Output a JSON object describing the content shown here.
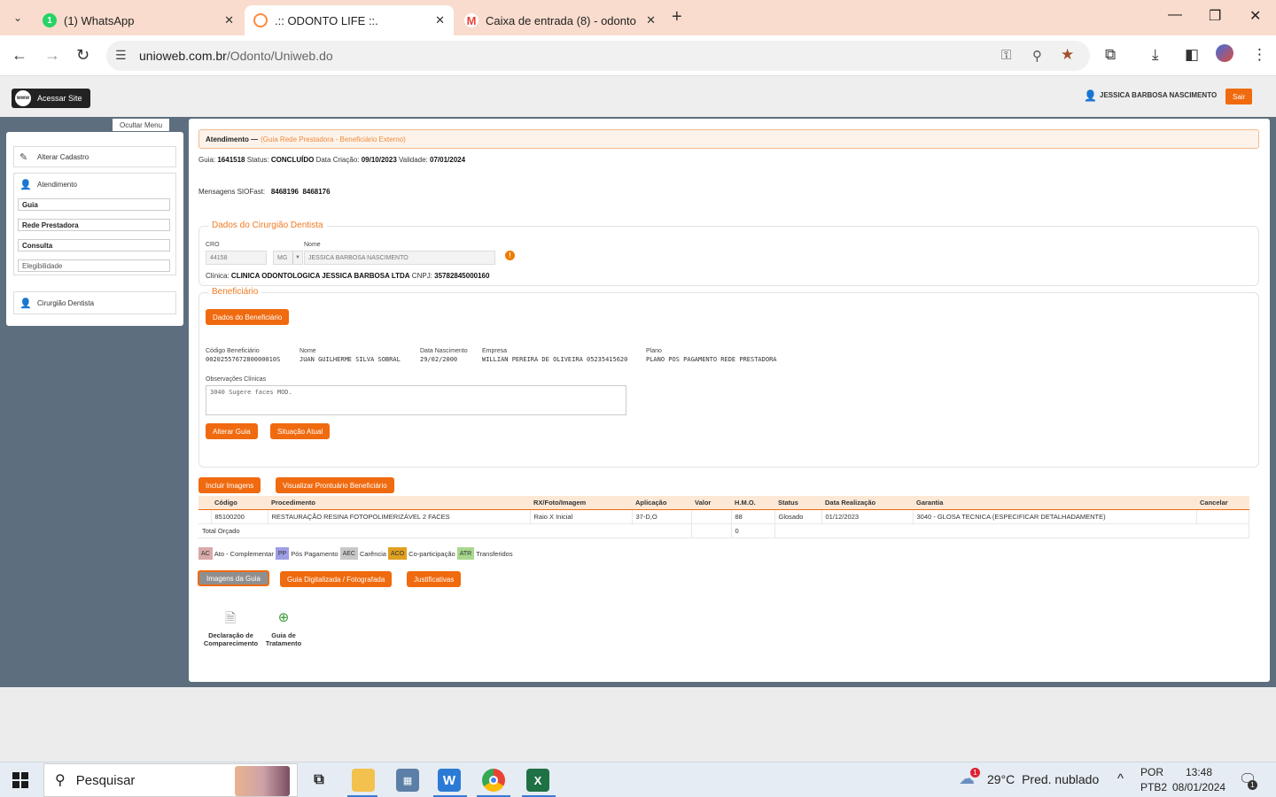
{
  "browser": {
    "tabs": [
      {
        "label": "(1) WhatsApp",
        "icon": "whatsapp-icon",
        "color": "#25d366"
      },
      {
        "label": ".:: ODONTO LIFE ::.",
        "icon": "odonto-icon",
        "color": "#ff8a3a"
      },
      {
        "label": "Caixa de entrada (8) - odontom",
        "icon": "gmail-icon",
        "color": "#ea4335"
      }
    ],
    "url_host": "unioweb.com.br",
    "url_path": "/Odonto/Uniweb.do"
  },
  "header": {
    "site_button": "Acessar Site",
    "site_badge": "www",
    "user_name": "JESSICA BARBOSA NASCIMENTO",
    "logout": "Sair"
  },
  "sidebar": {
    "hide_menu": "Ocultar Menu",
    "alterar_cadastro": "Alterar Cadastro",
    "atendimento": "Atendimento",
    "sub_items": [
      "Guia",
      "Rede Prestadora",
      "Consulta",
      "Elegibilidade"
    ],
    "cirurgiao": "Cirurgião Dentista"
  },
  "main": {
    "title": "Atendimento",
    "title_sep": "—",
    "subtitle": "(Guia Rede Prestadora - Beneficiário Externo)",
    "guia_label": "Guia:",
    "guia_value": "1641518",
    "status_label": "Status:",
    "status_value": "CONCLUÍDO",
    "criacao_label": "Data Criação:",
    "criacao_value": "09/10/2023",
    "validade_label": "Validade:",
    "validade_value": "07/01/2024",
    "siofast_label": "Mensagens SIOFast:",
    "siofast_values": [
      "8468196",
      "8468176"
    ]
  },
  "dentista": {
    "legend": "Dados do Cirurgião Dentista",
    "cro_label": "CRO",
    "cro_value": "44158",
    "uf_value": "MG",
    "nome_label": "Nome",
    "nome_value": "JESSICA BARBOSA NASCIMENTO",
    "clinica_label": "Clínica:",
    "clinica_value": "CLINICA ODONTOLOGICA JESSICA BARBOSA LTDA",
    "cnpj_label": "CNPJ:",
    "cnpj_value": "35782845000160"
  },
  "beneficiario": {
    "legend": "Beneficiário",
    "dados_button": "Dados do Beneficiário",
    "codigo_label": "Código Beneficiário",
    "codigo_value": "0020255767280000010S",
    "nome_label": "Nome",
    "nome_value": "JUAN GUILHERME SILVA SOBRAL",
    "nasc_label": "Data Nascimento",
    "nasc_value": "29/02/2000",
    "empresa_label": "Empresa",
    "empresa_value": "WILLIAN PEREIRA DE OLIVEIRA 05235415620",
    "plano_label": "Plano",
    "plano_value": "PLANO POS PAGAMENTO REDE PRESTADORA",
    "obs_label": "Observações Clínicas",
    "obs_value": "3040 Sugere faces MOD.",
    "alterar_button": "Alterar Guia",
    "situacao_button": "Situação Atual"
  },
  "actions": {
    "incluir_imagens": "Incluir Imagens",
    "visualizar_prontuario": "Visualizar Prontuário Beneficiário"
  },
  "table": {
    "headers": [
      "Código",
      "Procedimento",
      "RX/Foto/Imagem",
      "Aplicação",
      "Valor",
      "H.M.O.",
      "Status",
      "Data Realização",
      "Garantia",
      "Cancelar"
    ],
    "row": [
      "85100200",
      "RESTAURAÇÃO RESINA FOTOPOLIMERIZÁVEL 2 FACES",
      "Raio X Inicial",
      "37-D,O",
      "",
      "88",
      "Glosado",
      "01/12/2023",
      "3040 - GLOSA TECNICA (ESPECIFICAR DETALHADAMENTE)",
      ""
    ],
    "total_label": "Total Orçado",
    "total_hmo": "0"
  },
  "legend": [
    {
      "code": "AC",
      "label": "Ato - Complementar",
      "color": "#d9a9a9"
    },
    {
      "code": "PP",
      "label": "Pós Pagamento",
      "color": "#9e9ee6"
    },
    {
      "code": "AEC",
      "label": "Carência",
      "color": "#c8c8c8"
    },
    {
      "code": "ACO",
      "label": "Co-participação",
      "color": "#e0a020"
    },
    {
      "code": "ATR",
      "label": "Transferidos",
      "color": "#a8d88e"
    }
  ],
  "bottom_buttons": {
    "imagens_guia": "Imagens da Guia",
    "guia_digitalizada": "Guia Digitalizada / Fotografada",
    "justificativas": "Justificativas"
  },
  "docs": [
    {
      "line1": "Declaração de",
      "line2": "Comparecimento",
      "icon": "document-icon"
    },
    {
      "line1": "Guia de",
      "line2": "Tratamento",
      "icon": "treatment-icon"
    }
  ],
  "taskbar": {
    "search_placeholder": "Pesquisar",
    "weather_temp": "29°C",
    "weather_text": "Pred. nublado",
    "weather_badge": "1",
    "lang1": "POR",
    "lang2": "PTB2",
    "time": "13:48",
    "date": "08/01/2024",
    "notif_count": "1"
  }
}
